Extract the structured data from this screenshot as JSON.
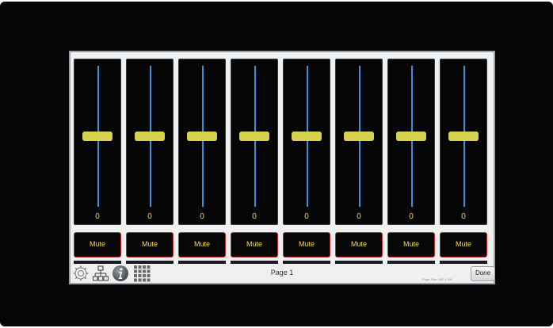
{
  "channels": [
    {
      "value": "0",
      "mute_label": "Mute"
    },
    {
      "value": "0",
      "mute_label": "Mute"
    },
    {
      "value": "0",
      "mute_label": "Mute"
    },
    {
      "value": "0",
      "mute_label": "Mute"
    },
    {
      "value": "0",
      "mute_label": "Mute"
    },
    {
      "value": "0",
      "mute_label": "Mute"
    },
    {
      "value": "0",
      "mute_label": "Mute"
    },
    {
      "value": "0",
      "mute_label": "Mute"
    }
  ],
  "toolbar": {
    "page_label": "Page 1",
    "page_size": "Page Size: 552 x 344",
    "done_label": "Done",
    "icons": [
      "settings-gear-icon",
      "network-tree-icon",
      "info-icon",
      "grid-icon"
    ]
  },
  "colors": {
    "track": "#3a8fe0",
    "knob": "#d6d24e",
    "value_text": "#f1d24a",
    "mute_border": "#c62828",
    "mute_text": "#ffd84a"
  }
}
